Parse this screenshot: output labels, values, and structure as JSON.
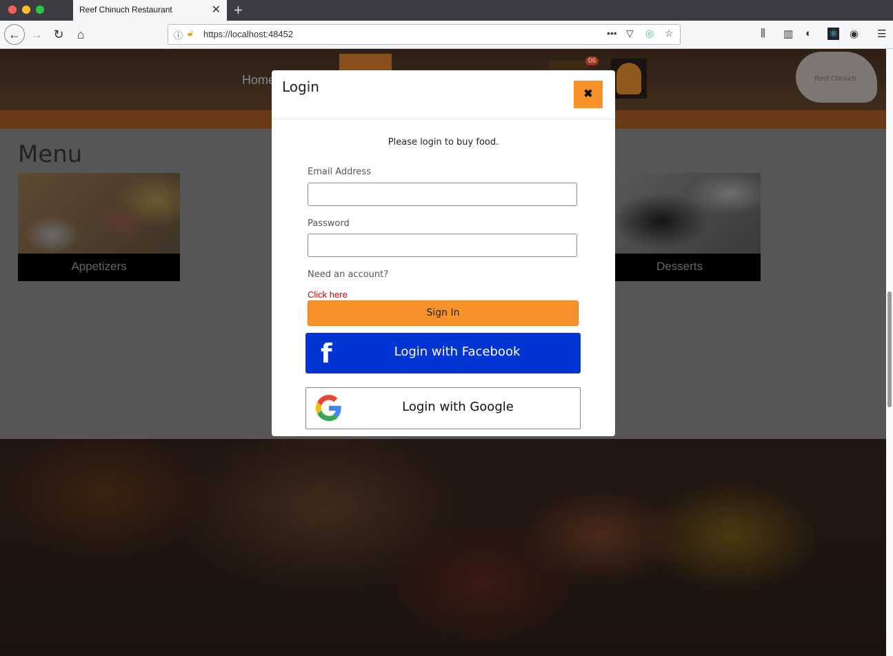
{
  "browser": {
    "tab_title": "Reef Chinuch Restaurant",
    "url": "https://localhost:48452"
  },
  "header": {
    "nav_home": "Home",
    "cart_count": "06",
    "logo_text": "Reef Chinuch"
  },
  "menu": {
    "title": "Menu",
    "categories": [
      {
        "label": "Appetizers"
      },
      {
        "label": "Desserts"
      }
    ]
  },
  "modal": {
    "title": "Login",
    "message": "Please login to buy food.",
    "email_label": "Email Address",
    "password_label": "Password",
    "need_account": "Need an account?",
    "click_here": "Click here",
    "sign_in": "Sign In",
    "facebook_label": "Login with Facebook",
    "google_label": "Login with Google"
  },
  "colors": {
    "accent": "#f7912a",
    "facebook": "#0035d4",
    "link": "#d00000"
  }
}
